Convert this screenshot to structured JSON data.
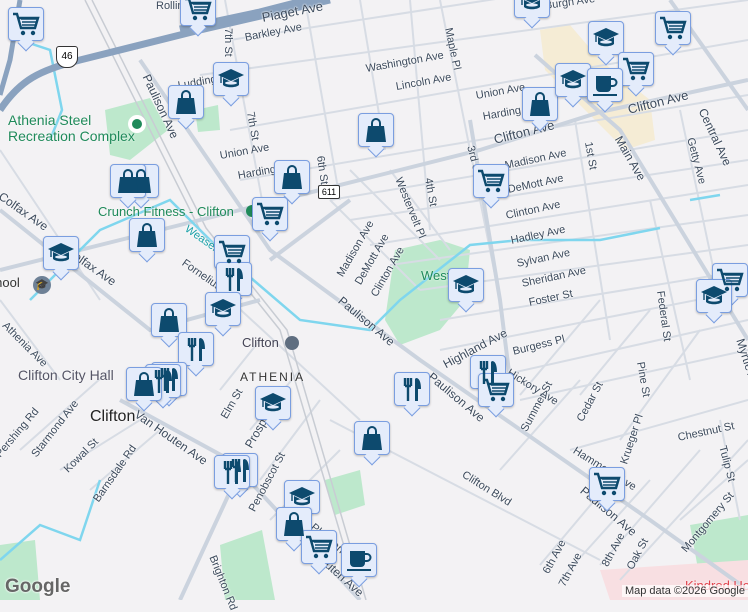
{
  "map": {
    "streets": [
      "Rollin",
      "Piaget Ave",
      "Barkley Ave",
      "7th St",
      "Washington Ave",
      "Lincoln Ave",
      "Union Ave",
      "Harding",
      "Maple Pl",
      "3rd St",
      "Clifton Ave",
      "Clifton Ave",
      "Madison Ave",
      "DeMott Ave",
      "Clinton Ave",
      "Hadley Ave",
      "Sylvan Ave",
      "Sheridan Ave",
      "Foster St",
      "Burgess Pl",
      "Highland Ave",
      "Main Ave",
      "Central Ave",
      "Getty Ave",
      "1st St",
      "4th St",
      "Westervelt Pl",
      "6th St",
      "7th St",
      "Paulison Ave",
      "Paulison Ave",
      "Paulison Ave",
      "Paulison Ave",
      "Madison Ave",
      "DeMott Ave",
      "Clinton Ave",
      "Federal St",
      "Pine St",
      "Cedar St",
      "Summer St",
      "Krueger Pl",
      "Hammond Ave",
      "Chestnut St",
      "Tulip St",
      "Myrtle Ave",
      "Montgomery St",
      "6th Ave",
      "7th Ave",
      "8th Ave",
      "Oak St",
      "Clifton Blvd",
      "Hickory Ave",
      "Colfax Ave",
      "Colfax Ave",
      "Fornelius",
      "Weasel",
      "Athenia Ave",
      "Elm St",
      "Prospect Ave",
      "Penobscot St",
      "Van Houten Ave",
      "Van Houten Ave",
      "Starmond Ave",
      "Kowal St",
      "Barnsdale Rd",
      "Pershing Rd",
      "Brighton Rd",
      "Union Ave",
      "Harding",
      "Ludding",
      "Pleasant Ave",
      "Burgh Ave"
    ],
    "route_shields": [
      "46",
      "611"
    ],
    "places": {
      "rec": "Athenia Steel Recreation Complex",
      "rec2": "Athenia Steel",
      "rec3": "Recreation Complex",
      "gym": "Crunch Fitness - Clifton",
      "school": "School",
      "hall": "Clifton City Hall",
      "city": "Clifton",
      "station": "Clifton",
      "neighborhood": "ATHENIA",
      "park": "West Brook Park",
      "hospital": "Kindred Hospital"
    },
    "attribution": "Map data ©2026 Google",
    "logo": "Google"
  },
  "colors": {
    "marker_bg": "#e4ecfb",
    "marker_border": "#7a9ee0",
    "icon": "#0d4a6e",
    "park": "#bde8cc",
    "road": "#d4dae3",
    "highway": "#8aa2bf",
    "water": "#7fd6ee"
  }
}
